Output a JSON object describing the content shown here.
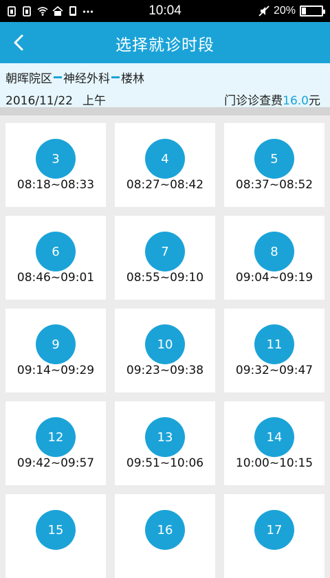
{
  "status_bar": {
    "time": "10:04",
    "battery": "20%",
    "battery_level": 0.2,
    "icons_left": [
      "sim-icon",
      "sim-icon",
      "wifi-icon",
      "home-icon",
      "phone-icon",
      "more-icon"
    ],
    "icons_right": [
      "mute-icon"
    ]
  },
  "header": {
    "title": "选择就诊时段",
    "back_icon": "chevron-left-icon"
  },
  "info": {
    "campus": "朝晖院区",
    "department": "神经外科",
    "doctor": "楼林",
    "date": "2016/11/22",
    "period": "上午",
    "fee_label": "门诊诊查费",
    "fee_amount": "16.0",
    "fee_unit": "元"
  },
  "colors": {
    "accent": "#1ba3d8",
    "info_bg": "#e6f6fc",
    "page_bg": "#ececec"
  },
  "slots": [
    {
      "number": "3",
      "time": "08:18~08:33"
    },
    {
      "number": "4",
      "time": "08:27~08:42"
    },
    {
      "number": "5",
      "time": "08:37~08:52"
    },
    {
      "number": "6",
      "time": "08:46~09:01"
    },
    {
      "number": "7",
      "time": "08:55~09:10"
    },
    {
      "number": "8",
      "time": "09:04~09:19"
    },
    {
      "number": "9",
      "time": "09:14~09:29"
    },
    {
      "number": "10",
      "time": "09:23~09:38"
    },
    {
      "number": "11",
      "time": "09:32~09:47"
    },
    {
      "number": "12",
      "time": "09:42~09:57"
    },
    {
      "number": "13",
      "time": "09:51~10:06"
    },
    {
      "number": "14",
      "time": "10:00~10:15"
    },
    {
      "number": "15",
      "time": ""
    },
    {
      "number": "16",
      "time": ""
    },
    {
      "number": "17",
      "time": ""
    }
  ]
}
